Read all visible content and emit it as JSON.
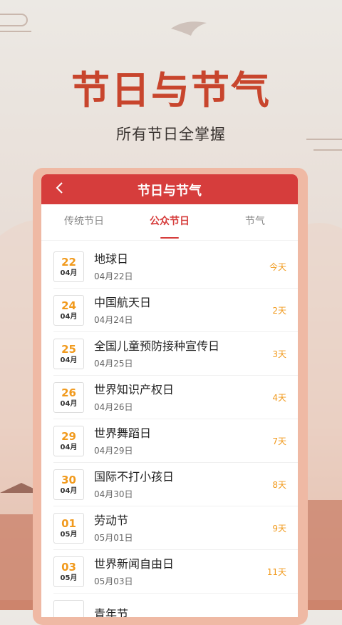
{
  "hero": {
    "title": "节日与节气",
    "subtitle": "所有节日全掌握"
  },
  "appbar": {
    "title": "节日与节气",
    "back_icon": "chevron-left-icon"
  },
  "tabs": [
    {
      "label": "传统节日",
      "active": false
    },
    {
      "label": "公众节日",
      "active": true
    },
    {
      "label": "节气",
      "active": false
    }
  ],
  "festivals": [
    {
      "day": "22",
      "month": "04月",
      "name": "地球日",
      "date": "04月22日",
      "remain": "今天"
    },
    {
      "day": "24",
      "month": "04月",
      "name": "中国航天日",
      "date": "04月24日",
      "remain": "2天"
    },
    {
      "day": "25",
      "month": "04月",
      "name": "全国儿童预防接种宣传日",
      "date": "04月25日",
      "remain": "3天"
    },
    {
      "day": "26",
      "month": "04月",
      "name": "世界知识产权日",
      "date": "04月26日",
      "remain": "4天"
    },
    {
      "day": "29",
      "month": "04月",
      "name": "世界舞蹈日",
      "date": "04月29日",
      "remain": "7天"
    },
    {
      "day": "30",
      "month": "04月",
      "name": "国际不打小孩日",
      "date": "04月30日",
      "remain": "8天"
    },
    {
      "day": "01",
      "month": "05月",
      "name": "劳动节",
      "date": "05月01日",
      "remain": "9天"
    },
    {
      "day": "03",
      "month": "05月",
      "name": "世界新闻自由日",
      "date": "05月03日",
      "remain": "11天"
    },
    {
      "day": "",
      "month": "",
      "name": "青年节",
      "date": "",
      "remain": ""
    }
  ],
  "colors": {
    "brand_red": "#d63d3c",
    "accent_orange": "#f19a1d",
    "hero_red": "#c8452d"
  }
}
